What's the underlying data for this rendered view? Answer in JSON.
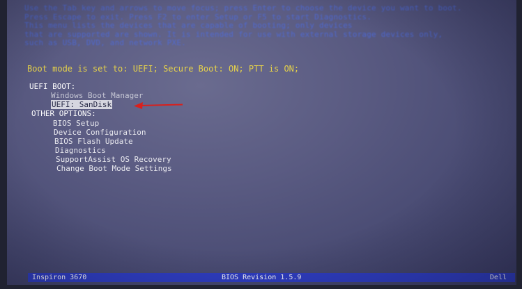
{
  "description_lines": [
    "Use the Tab key and arrows to move focus; press Enter to choose the device you want to boot.",
    "Press Escape to exit. Press F2 to enter Setup or F5 to start Diagnostics.",
    "This menu lists the devices that are capable of booting; only devices",
    "that are supported are shown. It is intended for use with external storage devices only,",
    "such as USB, DVD, and network PXE."
  ],
  "status_line": "Boot mode is set to: UEFI; Secure Boot: ON; PTT is ON;",
  "uefi_boot": {
    "heading": "UEFI BOOT:",
    "items": [
      "Windows Boot Manager",
      "UEFI: SanDisk"
    ]
  },
  "other_options": {
    "heading": "OTHER OPTIONS:",
    "items": [
      "BIOS Setup",
      "Device Configuration",
      "BIOS Flash Update",
      "Diagnostics",
      "SupportAssist OS Recovery",
      "Change Boot Mode Settings"
    ]
  },
  "footer": {
    "model": "Inspiron 3670",
    "bios_revision": "BIOS Revision 1.5.9",
    "brand": "Dell"
  },
  "colors": {
    "status_yellow": "#e6d24a",
    "description_blue": "#4b6ce6",
    "statusbar_blue": "#2f3ec4",
    "arrow_red": "#d9201c"
  },
  "icons": {
    "pointer": "red-arrow-icon"
  }
}
